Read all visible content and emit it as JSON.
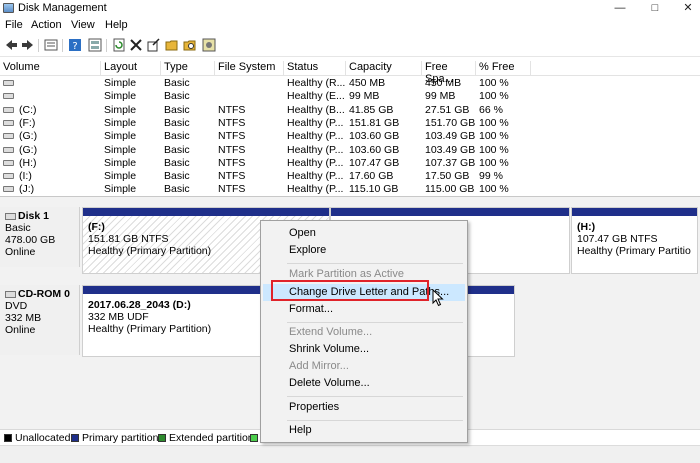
{
  "window": {
    "title": "Disk Management",
    "min": "—",
    "max": "□",
    "close": "✕"
  },
  "menu": [
    "File",
    "Action",
    "View",
    "Help"
  ],
  "volume_table": {
    "columns": [
      "Volume",
      "Layout",
      "Type",
      "File System",
      "Status",
      "Capacity",
      "Free Spa...",
      "% Free"
    ],
    "rows": [
      [
        "",
        "Simple",
        "Basic",
        "",
        "Healthy (R...",
        "450 MB",
        "450 MB",
        "100 %"
      ],
      [
        "",
        "Simple",
        "Basic",
        "",
        "Healthy (E...",
        "99 MB",
        "99 MB",
        "100 %"
      ],
      [
        "(C:)",
        "Simple",
        "Basic",
        "NTFS",
        "Healthy (B...",
        "41.85 GB",
        "27.51 GB",
        "66 %"
      ],
      [
        "(F:)",
        "Simple",
        "Basic",
        "NTFS",
        "Healthy (P...",
        "151.81 GB",
        "151.70 GB",
        "100 %"
      ],
      [
        "(G:)",
        "Simple",
        "Basic",
        "NTFS",
        "Healthy (P...",
        "103.60 GB",
        "103.49 GB",
        "100 %"
      ],
      [
        "(G:)",
        "Simple",
        "Basic",
        "NTFS",
        "Healthy (P...",
        "103.60 GB",
        "103.49 GB",
        "100 %"
      ],
      [
        "(H:)",
        "Simple",
        "Basic",
        "NTFS",
        "Healthy (P...",
        "107.47 GB",
        "107.37 GB",
        "100 %"
      ],
      [
        "(I:)",
        "Simple",
        "Basic",
        "NTFS",
        "Healthy (P...",
        "17.60 GB",
        "17.50 GB",
        "99 %"
      ],
      [
        "(J:)",
        "Simple",
        "Basic",
        "NTFS",
        "Healthy (P...",
        "115.10 GB",
        "115.00 GB",
        "100 %"
      ]
    ]
  },
  "disks": {
    "disk1": {
      "name": "Disk 1",
      "type": "Basic",
      "size": "478.00 GB",
      "status": "Online",
      "part_f": {
        "name": "(F:)",
        "detail": "151.81 GB NTFS",
        "status": "Healthy (Primary Partition)"
      },
      "part_h": {
        "name": "(H:)",
        "detail": "107.47 GB NTFS",
        "status": "Healthy (Primary Partitio"
      }
    },
    "cdrom0": {
      "name": "CD-ROM 0",
      "type": "DVD",
      "size": "332 MB",
      "status": "Online",
      "part_d": {
        "name": "2017.06.28_2043  (D:)",
        "detail": "332 MB UDF",
        "status": "Healthy (Primary Partition)"
      }
    }
  },
  "legend": [
    "Unallocated",
    "Primary partition",
    "Extended partition"
  ],
  "context_menu": {
    "open": "Open",
    "explore": "Explore",
    "mark_active": "Mark Partition as Active",
    "change_letter": "Change Drive Letter and Paths...",
    "format": "Format...",
    "extend": "Extend Volume...",
    "shrink": "Shrink Volume...",
    "add_mirror": "Add Mirror...",
    "delete": "Delete Volume...",
    "properties": "Properties",
    "help": "Help"
  },
  "colors": {
    "primary_bar": "#1f2f8a",
    "highlight": "#e0232a",
    "legend_unallocated": "#000000",
    "legend_primary": "#1f2f8a",
    "legend_extended": "#2e8b2e"
  },
  "toolbar_icons": [
    "back-icon",
    "forward-icon",
    "list-icon",
    "help-icon",
    "properties-icon",
    "refresh-icon",
    "delete-icon",
    "check-icon",
    "open-folder-icon",
    "search-icon",
    "settings-icon"
  ]
}
